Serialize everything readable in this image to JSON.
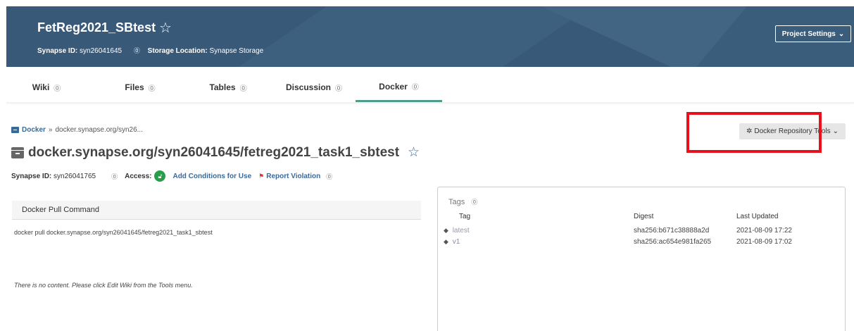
{
  "header": {
    "project_title": "FetReg2021_SBtest",
    "synapse_id_label": "Synapse ID:",
    "synapse_id": "syn26041645",
    "storage_label": "Storage Location:",
    "storage_value": "Synapse Storage",
    "settings_button": "Project Settings"
  },
  "tabs": [
    {
      "label": "Wiki"
    },
    {
      "label": "Files"
    },
    {
      "label": "Tables"
    },
    {
      "label": "Discussion"
    },
    {
      "label": "Docker"
    }
  ],
  "breadcrumb": {
    "root": "Docker",
    "separator": "»",
    "current": "docker.synapse.org/syn26..."
  },
  "tools_button": "Docker Repository Tools",
  "entity": {
    "title": "docker.synapse.org/syn26041645/fetreg2021_task1_sbtest",
    "synapse_id_label": "Synapse ID:",
    "synapse_id": "syn26041765",
    "access_label": "Access:",
    "add_conditions": "Add Conditions for Use",
    "report_violation": "Report Violation"
  },
  "pull": {
    "header": "Docker Pull Command",
    "command": "docker pull docker.synapse.org/syn26041645/fetreg2021_task1_sbtest",
    "no_content": "There is no content. Please click Edit Wiki from the Tools menu."
  },
  "tags": {
    "title": "Tags",
    "columns": [
      "Tag",
      "Digest",
      "Last Updated"
    ],
    "rows": [
      {
        "tag": "latest",
        "digest": "sha256:b671c38888a2d",
        "updated": "2021-08-09 17:22"
      },
      {
        "tag": "v1",
        "digest": "sha256:ac654e981fa265",
        "updated": "2021-08-09 17:02"
      }
    ]
  },
  "colors": {
    "header_bg": "#395979",
    "active_tab": "#4d9c8c",
    "link": "#3a6a99",
    "highlight_box": "#e8101a",
    "access_open": "#2a9d4a"
  }
}
